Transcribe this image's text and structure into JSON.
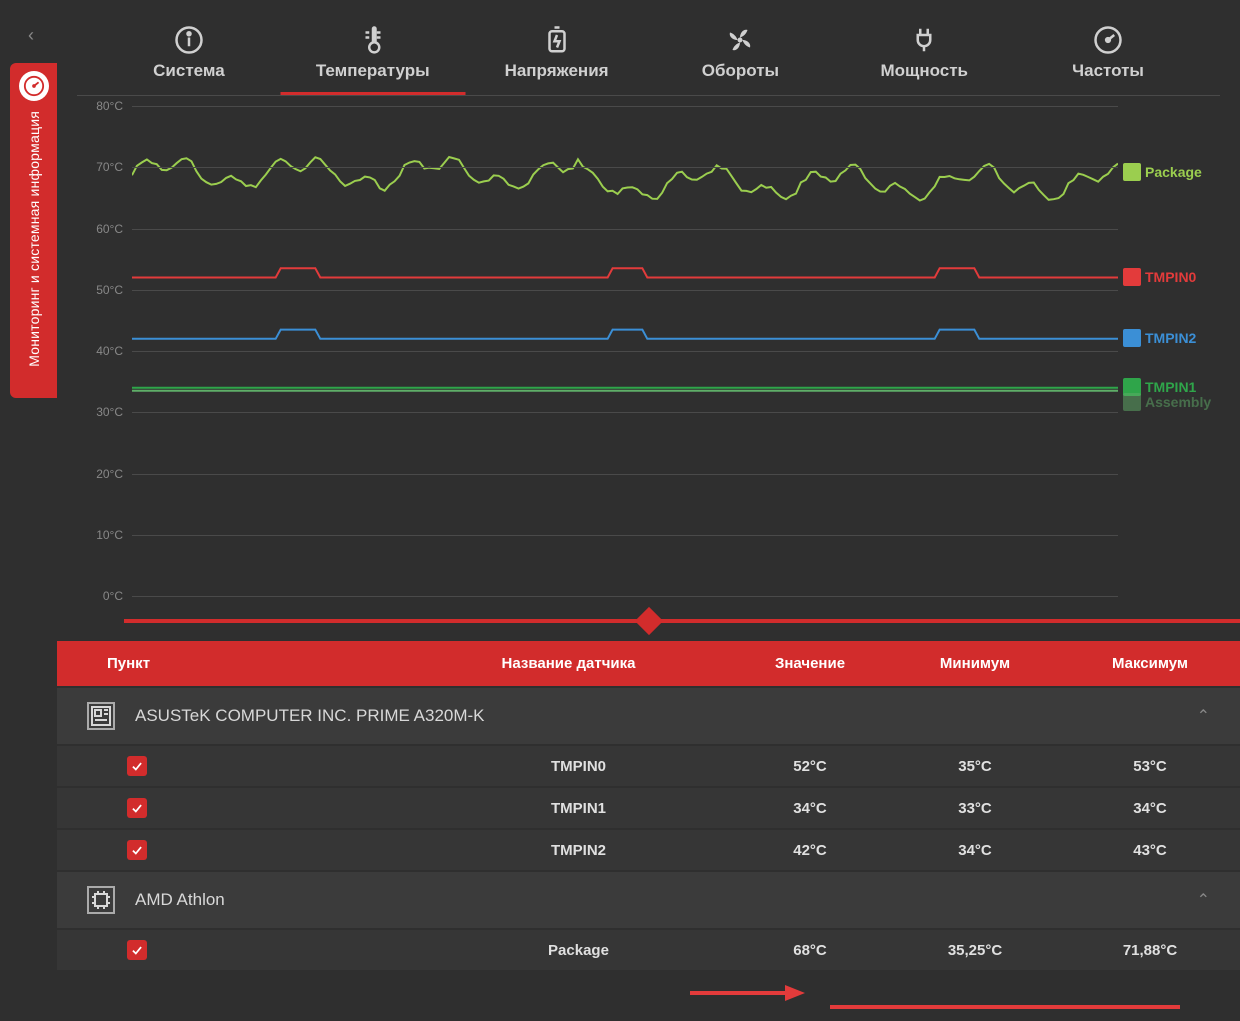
{
  "sidebar": {
    "label": "Мониторинг и системная информация"
  },
  "tabs": [
    {
      "id": "system",
      "label": "Система",
      "icon": "info-icon",
      "active": false
    },
    {
      "id": "temps",
      "label": "Температуры",
      "icon": "thermo-icon",
      "active": true
    },
    {
      "id": "volt",
      "label": "Напряжения",
      "icon": "battery-icon",
      "active": false
    },
    {
      "id": "fans",
      "label": "Обороты",
      "icon": "fan-icon",
      "active": false
    },
    {
      "id": "power",
      "label": "Мощность",
      "icon": "plug-icon",
      "active": false
    },
    {
      "id": "freq",
      "label": "Частоты",
      "icon": "gauge-icon",
      "active": false
    }
  ],
  "chart_data": {
    "type": "line",
    "ylabel_unit": "°C",
    "ylim": [
      0,
      80
    ],
    "yticks": [
      0,
      10,
      20,
      30,
      40,
      50,
      60,
      70,
      80
    ],
    "legend_extra": "Assembly",
    "series": [
      {
        "name": "Package",
        "color": "#9bce4f",
        "approx_level": 69,
        "noisy": true
      },
      {
        "name": "TMPIN0",
        "color": "#e33b3b",
        "approx_level": 52,
        "noisy": false,
        "bumps": 3
      },
      {
        "name": "TMPIN2",
        "color": "#3b8fd6",
        "approx_level": 42,
        "noisy": false,
        "bumps": 3
      },
      {
        "name": "TMPIN1",
        "color": "#2fa54a",
        "approx_level": 34,
        "noisy": false
      },
      {
        "name": "Assembly",
        "color": "#5fae68",
        "approx_level": 33.5,
        "noisy": false,
        "hidden_legend": true
      }
    ]
  },
  "table": {
    "headers": {
      "item": "Пункт",
      "sensor": "Название датчика",
      "value": "Значение",
      "min": "Минимум",
      "max": "Максимум"
    },
    "groups": [
      {
        "icon": "motherboard-icon",
        "title": "ASUSTeK COMPUTER INC. PRIME A320M-K",
        "rows": [
          {
            "checked": true,
            "sensor": "TMPIN0",
            "value": "52°C",
            "min": "35°C",
            "max": "53°C"
          },
          {
            "checked": true,
            "sensor": "TMPIN1",
            "value": "34°C",
            "min": "33°C",
            "max": "34°C"
          },
          {
            "checked": true,
            "sensor": "TMPIN2",
            "value": "42°C",
            "min": "34°C",
            "max": "43°C"
          }
        ]
      },
      {
        "icon": "cpu-icon",
        "title": "AMD Athlon",
        "rows": [
          {
            "checked": true,
            "sensor": "Package",
            "value": "68°C",
            "min": "35,25°C",
            "max": "71,88°C",
            "highlight": true
          }
        ]
      }
    ]
  }
}
